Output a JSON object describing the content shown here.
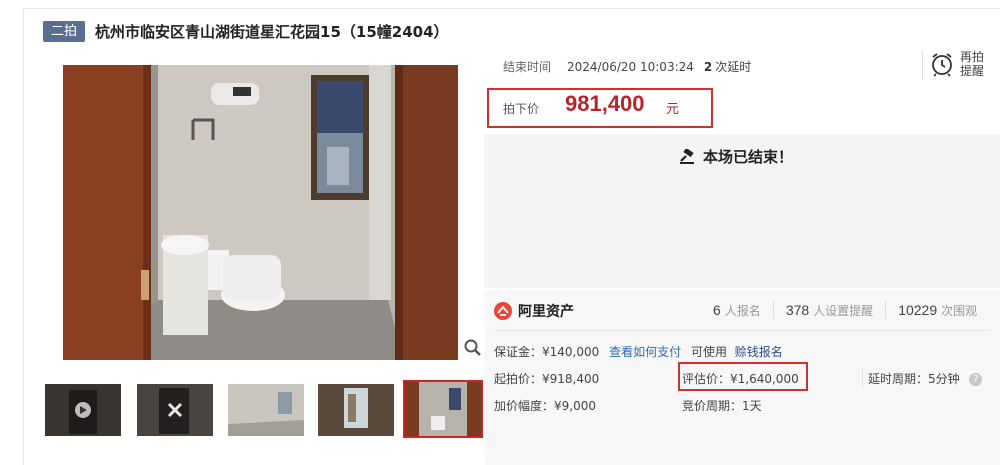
{
  "header": {
    "tag": "二拍",
    "title": "杭州市临安区青山湖街道星汇花园15（15幢2404）"
  },
  "auction": {
    "end_time_label": "结束时间",
    "end_time": "2024/06/20 10:03:24",
    "extensions_count": "2",
    "extensions_label": "次延时",
    "remind_label": "再拍提醒",
    "price_label": "拍下价",
    "price_value": "981,400",
    "price_unit": "元",
    "ended_message": "本场已结束！"
  },
  "platform": {
    "brand_name": "阿里资产",
    "signups": "6",
    "signups_label": "人报名",
    "reminders": "378",
    "reminders_label": "人设置提醒",
    "views": "10229",
    "views_label": "次围观"
  },
  "details": {
    "deposit": "保证金：¥140,000",
    "how_to_pay": "查看如何支付",
    "can_use": "可使用",
    "credit_signup": "赊钱报名",
    "start_price": "起拍价：¥918,400",
    "eval_price": "评估价：¥1,640,000",
    "delay_period": "延时周期：5分钟",
    "increment": "加价幅度：¥9,000",
    "bid_period": "竞价周期：1天"
  },
  "icons": {
    "zoom": "magnifier-icon",
    "alarm": "alarm-clock-icon",
    "gavel": "gavel-icon",
    "brand": "ali-asset-logo-icon",
    "help": "question-icon"
  },
  "colors": {
    "tag_bg": "#5a6f8f",
    "price_red": "#b9232c",
    "highlight_box": "#d32f2f",
    "link_blue": "#2b6cb0"
  }
}
